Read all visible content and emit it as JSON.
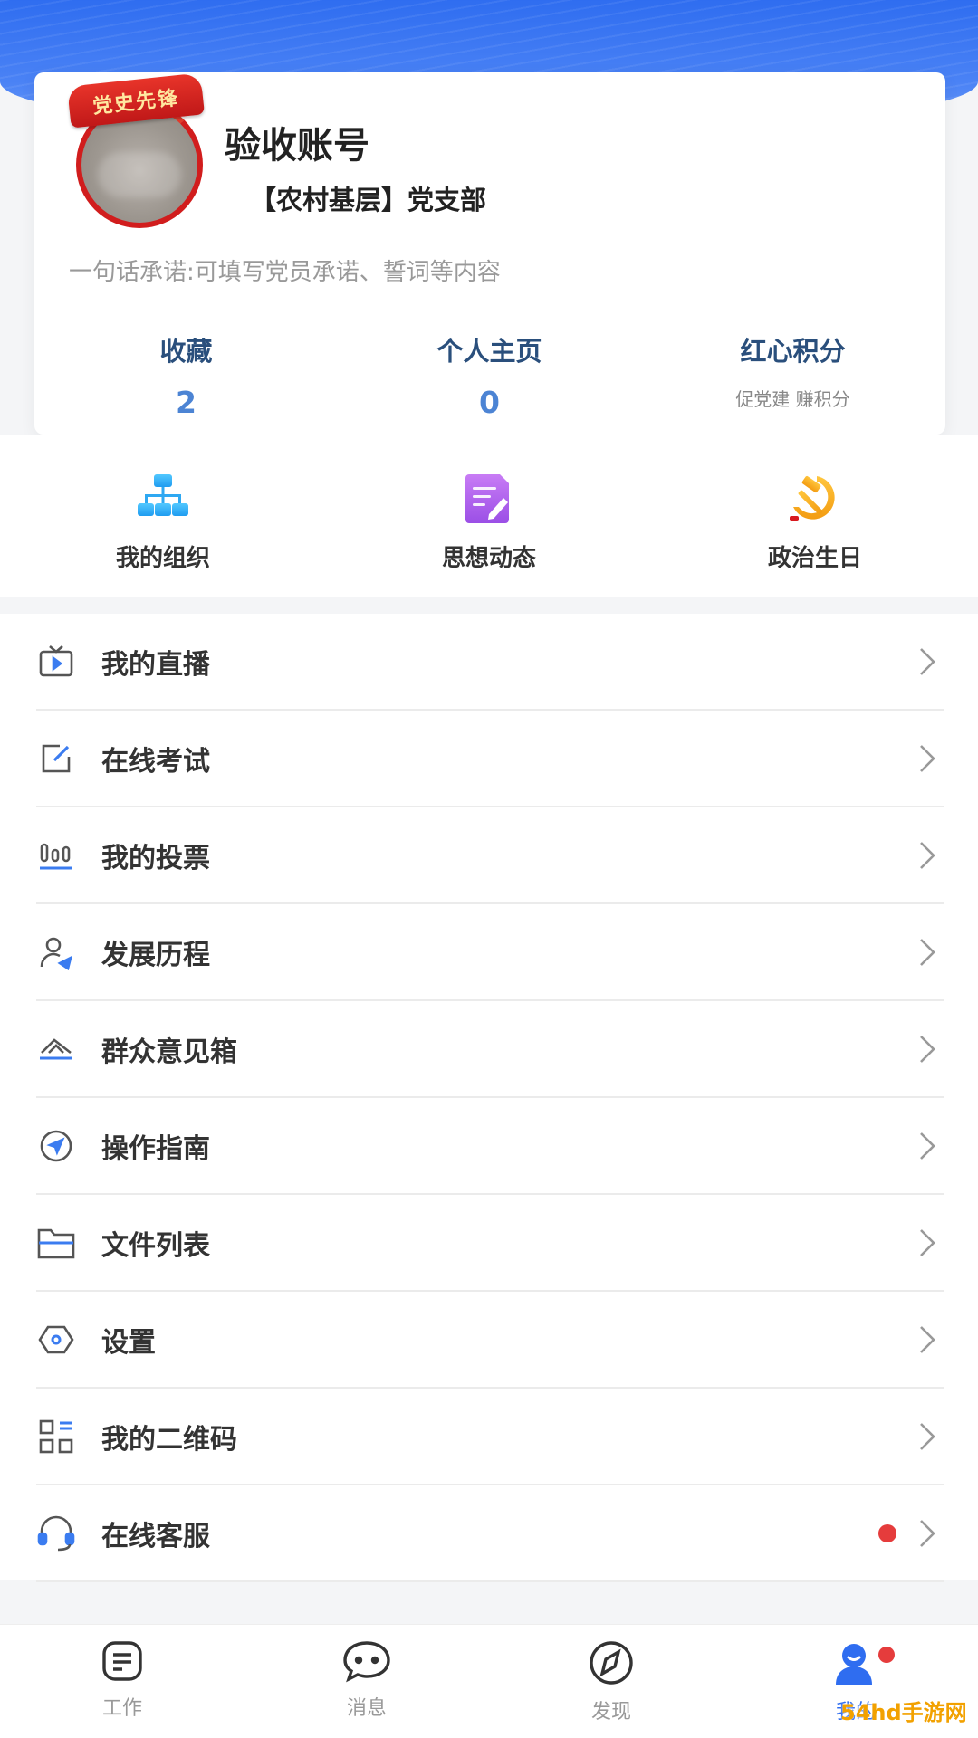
{
  "profile": {
    "badge_text": "党史先锋",
    "name": "验收账号",
    "branch": "【农村基层】党支部",
    "pledge": "一句话承诺:可填写党员承诺、誓词等内容"
  },
  "stats": [
    {
      "label": "收藏",
      "value": "2"
    },
    {
      "label": "个人主页",
      "value": "0"
    },
    {
      "label": "红心积分",
      "sub": "促党建 赚积分"
    }
  ],
  "quick_actions": [
    {
      "label": "我的组织",
      "icon": "org-chart-icon"
    },
    {
      "label": "思想动态",
      "icon": "note-edit-icon"
    },
    {
      "label": "政治生日",
      "icon": "hammer-sickle-icon"
    }
  ],
  "menu": [
    {
      "label": "我的直播",
      "icon": "tv-live-icon"
    },
    {
      "label": "在线考试",
      "icon": "edit-square-icon"
    },
    {
      "label": "我的投票",
      "icon": "bar-vote-icon"
    },
    {
      "label": "发展历程",
      "icon": "user-progress-icon"
    },
    {
      "label": "群众意见箱",
      "icon": "mailbox-icon"
    },
    {
      "label": "操作指南",
      "icon": "compass-guide-icon"
    },
    {
      "label": "文件列表",
      "icon": "folder-icon"
    },
    {
      "label": "设置",
      "icon": "settings-hex-icon"
    },
    {
      "label": "我的二维码",
      "icon": "qr-code-icon"
    },
    {
      "label": "在线客服",
      "icon": "headset-icon",
      "has_dot": true
    }
  ],
  "tabbar": [
    {
      "label": "工作",
      "icon": "work-doc-icon"
    },
    {
      "label": "消息",
      "icon": "chat-bubble-icon"
    },
    {
      "label": "发现",
      "icon": "compass-icon"
    },
    {
      "label": "我的",
      "icon": "profile-icon",
      "active": true,
      "has_badge": true
    }
  ],
  "watermark": "54hd手游网",
  "colors": {
    "primary": "#2f6df0",
    "stat_label": "#2a4f7c",
    "stat_value": "#4c84d4",
    "badge_red": "#e53c3c"
  }
}
